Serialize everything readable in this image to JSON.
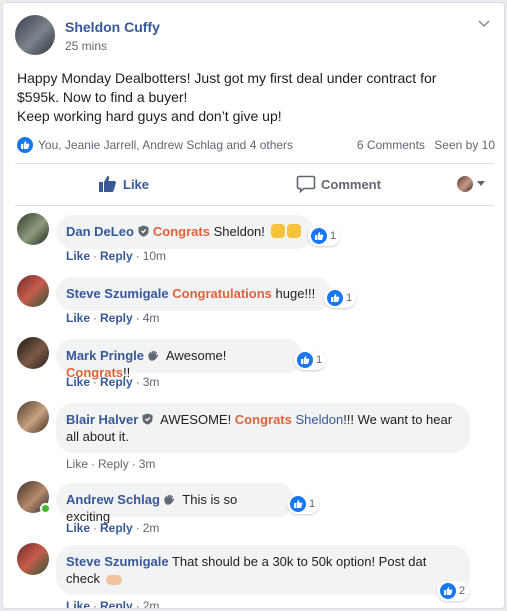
{
  "post": {
    "author": "Sheldon Cuffy",
    "time": "25 mins",
    "lines": [
      "Happy Monday Dealbotters! Just got my first deal under contract for",
      "$595k. Now to find a buyer!",
      "Keep working hard guys and don’t give up!"
    ],
    "reactors": "You, Jeanie Jarrell, Andrew Schlag and 4 others",
    "comments_count": "6 Comments",
    "seen_by": "Seen by 10"
  },
  "actions": {
    "like": "Like",
    "comment": "Comment"
  },
  "meta_labels": {
    "like": "Like",
    "reply": "Reply",
    "dot": "·"
  },
  "comments": [
    {
      "name": "Dan DeLeo",
      "tag": "Congrats",
      "text": " Sheldon! ",
      "time": "10m",
      "reactions": "1"
    },
    {
      "name": "Steve Szumigale",
      "tag": "Congratulations",
      "text": " huge!!!",
      "time": "4m",
      "reactions": "1"
    },
    {
      "name": "Mark Pringle",
      "pre": " Awesome! ",
      "tag": "Congrats",
      "text": "!!",
      "time": "3m",
      "reactions": "1"
    },
    {
      "name": "Blair Halver",
      "pre": " AWESOME! ",
      "tag": "Congrats",
      "mention": " Sheldon",
      "text": "!!! We want to hear",
      "line2": "all about it.",
      "time": "3m"
    },
    {
      "name": "Andrew Schlag",
      "text": " This is so exciting",
      "time": "2m",
      "reactions": "1"
    },
    {
      "name": "Steve Szumigale",
      "text": " That should be a 30k to 50k option! Post dat",
      "line2": "check ",
      "time": "2m",
      "reactions": "2"
    }
  ],
  "colors": {
    "link": "#385898",
    "tag": "#e0623a",
    "like_blue": "#1877f2",
    "bubble": "#f2f3f5"
  }
}
